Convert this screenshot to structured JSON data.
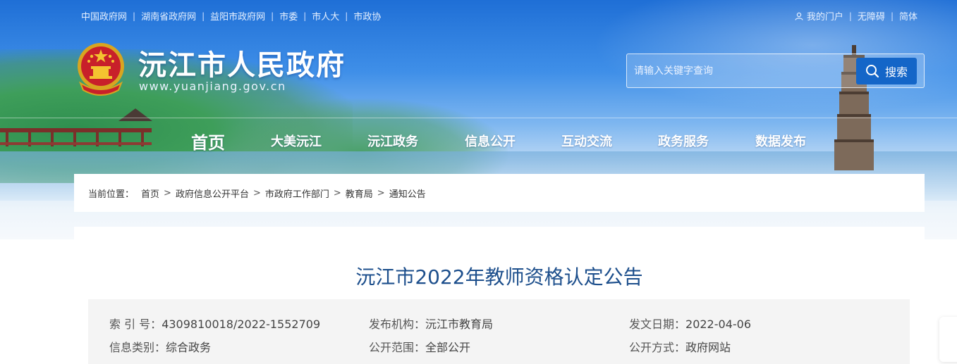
{
  "top_links": [
    "中国政府网",
    "湖南省政府网",
    "益阳市政府网",
    "市委",
    "市人大",
    "市政协"
  ],
  "user_links": {
    "portal": "我的门户",
    "accessibility": "无障碍",
    "simplified": "简体"
  },
  "site": {
    "title": "沅江市人民政府",
    "url": "www.yuanjiang.gov.cn"
  },
  "search": {
    "placeholder": "请输入关键字查询",
    "button": "搜索"
  },
  "nav": [
    "首页",
    "大美沅江",
    "沅江政务",
    "信息公开",
    "互动交流",
    "政务服务",
    "数据发布"
  ],
  "breadcrumb": {
    "label": "当前位置：",
    "items": [
      "首页",
      "政府信息公开平台",
      "市政府工作部门",
      "教育局",
      "通知公告"
    ]
  },
  "article": {
    "title": "沅江市2022年教师资格认定公告",
    "meta": {
      "index_key": "索 引 号：",
      "index_val": "4309810018/2022-1552709",
      "publisher_key": "发布机构：",
      "publisher_val": "沅江市教育局",
      "date_key": "发文日期：",
      "date_val": "2022-04-06",
      "category_key": "信息类别：",
      "category_val": "综合政务",
      "scope_key": "公开范围：",
      "scope_val": "全部公开",
      "method_key": "公开方式：",
      "method_val": "政府网站"
    }
  },
  "colors": {
    "header_blue": "#1f6fd6",
    "search_button": "#1466c8",
    "article_title": "#1d4f8c",
    "meta_bg": "#f4f4f4"
  }
}
